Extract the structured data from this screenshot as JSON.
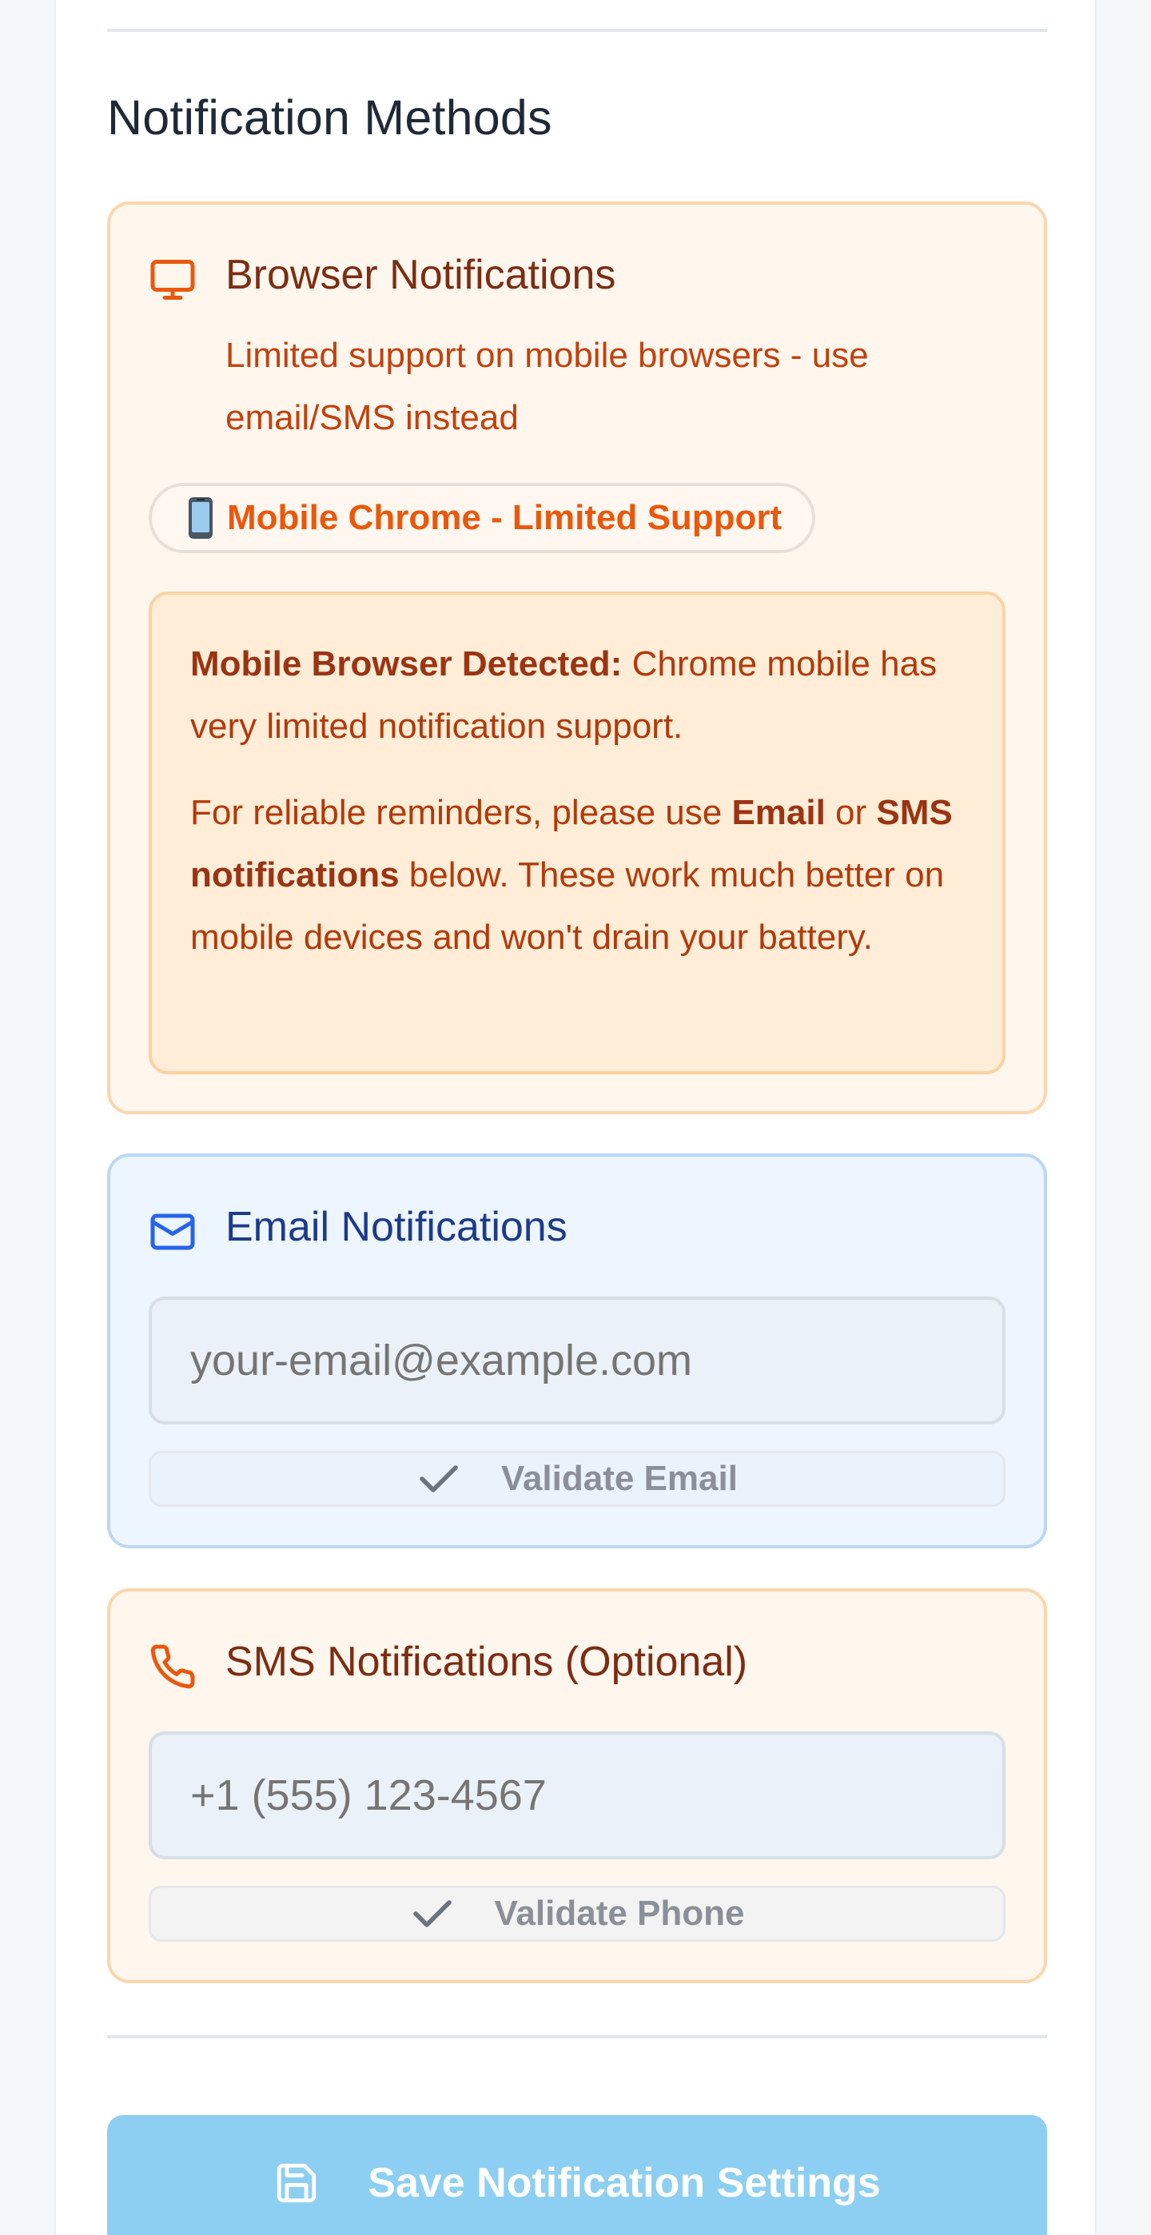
{
  "section": {
    "title": "Notification Methods"
  },
  "browser": {
    "icon": "monitor-icon",
    "title": "Browser Notifications",
    "description": "Limited support on mobile browsers - use email/SMS instead",
    "badge": {
      "icon": "mobile-phone-emoji",
      "label": "Mobile Chrome - Limited Support"
    },
    "warning": {
      "lead": "Mobile Browser Detected:",
      "line1": " Chrome mobile has very limited notification support.",
      "p2_a": "For reliable reminders, please use ",
      "p2_email": "Email",
      "p2_b": " or ",
      "p2_sms": "SMS notifications",
      "p2_c": " below. These work much better on mobile devices and won't drain your battery."
    }
  },
  "email": {
    "icon": "mail-icon",
    "title": "Email Notifications",
    "placeholder": "your-email@example.com",
    "value": "",
    "validate_label": "Validate Email"
  },
  "sms": {
    "icon": "phone-icon",
    "title": "SMS Notifications (Optional)",
    "placeholder": "+1 (555) 123-4567",
    "value": "",
    "validate_label": "Validate Phone"
  },
  "save": {
    "icon": "save-icon",
    "label": "Save Notification Settings"
  },
  "colors": {
    "warning_accent": "#ea580c",
    "email_accent": "#1e3a8a",
    "save_button": "#8ccff2"
  }
}
